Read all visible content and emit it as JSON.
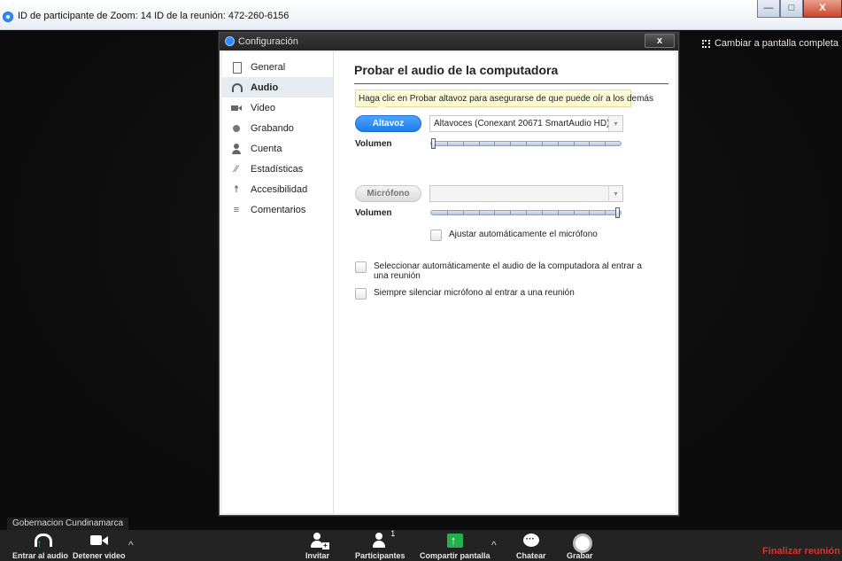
{
  "window": {
    "title": "ID de participante de Zoom: 14   ID de la reunión: 472-260-6156",
    "minimize": "—",
    "maximize": "□",
    "close": "X"
  },
  "stage": {
    "fullscreen_label": "Cambiar a pantalla completa",
    "participant_name": "Gobernacion Cundinamarca"
  },
  "toolbar": {
    "join_audio": "Entrar al audio",
    "stop_video": "Detener video",
    "invite": "Invitar",
    "participants": "Participantes",
    "participants_count": "1",
    "share_screen": "Compartir pantalla",
    "chat": "Chatear",
    "record": "Grabar",
    "end_meeting": "Finalizar reunión",
    "caret": "^"
  },
  "dialog": {
    "title": "Configuración",
    "close": "x",
    "sidebar": [
      {
        "label": "General",
        "icon": "document-icon"
      },
      {
        "label": "Audio",
        "icon": "headphones-icon",
        "active": true
      },
      {
        "label": "Video",
        "icon": "video-icon"
      },
      {
        "label": "Grabando",
        "icon": "record-icon"
      },
      {
        "label": "Cuenta",
        "icon": "person-icon"
      },
      {
        "label": "Estadísticas",
        "icon": "stats-icon"
      },
      {
        "label": "Accesibilidad",
        "icon": "accessibility-icon"
      },
      {
        "label": "Comentarios",
        "icon": "feedback-icon"
      }
    ],
    "content": {
      "heading": "Probar el audio de la computadora",
      "tooltip": "Haga clic en Probar altavoz para asegurarse de que puede oír a los demás",
      "speaker_button": "Altavoz",
      "speaker_device": "Altavoces (Conexant 20671 SmartAudio HD)",
      "volume_label": "Volumen",
      "speaker_volume": 0.0,
      "mic_button": "Micrófono",
      "mic_device": "",
      "mic_volume_label": "Volumen",
      "mic_volume": 1.0,
      "auto_mic": "Ajustar automáticamente el micrófono",
      "auto_join_audio": "Seleccionar automáticamente el audio de la computadora al entrar a una reunión",
      "mute_on_join": "Siempre silenciar micrófono al entrar a una reunión"
    }
  },
  "colors": {
    "accent": "#2d8cff",
    "end_meeting": "#e0302a",
    "share_green": "#22b14c"
  }
}
